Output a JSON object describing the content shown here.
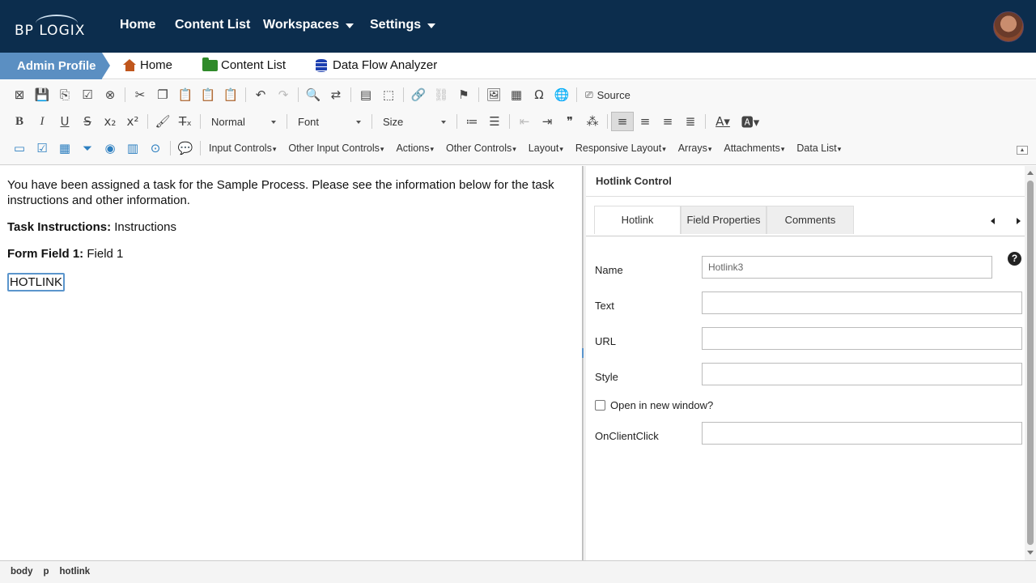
{
  "topnav": {
    "logo_text": "BP LOGIX",
    "items": [
      {
        "label": "Home",
        "has_menu": false
      },
      {
        "label": "Content List",
        "has_menu": false
      },
      {
        "label": "Workspaces",
        "has_menu": true
      },
      {
        "label": "Settings",
        "has_menu": true
      }
    ],
    "colors": {
      "background": "#0c2d4d",
      "text": "#ffffff"
    }
  },
  "breadcrumbs": {
    "active": "Admin Profile",
    "links": [
      {
        "label": "Home",
        "icon": "home-icon"
      },
      {
        "label": "Content List",
        "icon": "folder-icon"
      },
      {
        "label": "Data Flow Analyzer",
        "icon": "database-icon"
      }
    ],
    "active_color": "#5b8fc2"
  },
  "toolbar": {
    "source_label": "Source",
    "format_combo": "Normal",
    "font_combo": "Font",
    "size_combo": "Size",
    "menus": [
      "Input Controls",
      "Other Input Controls",
      "Actions",
      "Other Controls",
      "Layout",
      "Responsive Layout",
      "Arrays",
      "Attachments",
      "Data List"
    ]
  },
  "editor": {
    "intro": "You have been assigned a task for the Sample Process. Please see the information below for the task instructions and other information.",
    "task_label": "Task Instructions:",
    "task_value": "Instructions",
    "field_label": "Form Field 1:",
    "field_value": "Field 1",
    "hotlink_text": "HOTLINK"
  },
  "panel": {
    "title": "Hotlink Control",
    "tabs": [
      "Hotlink",
      "Field Properties",
      "Comments"
    ],
    "active_tab": "Hotlink",
    "fields": {
      "name_label": "Name",
      "name_value": "Hotlink3",
      "text_label": "Text",
      "url_label": "URL",
      "style_label": "Style",
      "new_window_label": "Open in new window?",
      "onclientclick_label": "OnClientClick"
    },
    "help_glyph": "?"
  },
  "pathbar": [
    "body",
    "p",
    "hotlink"
  ]
}
